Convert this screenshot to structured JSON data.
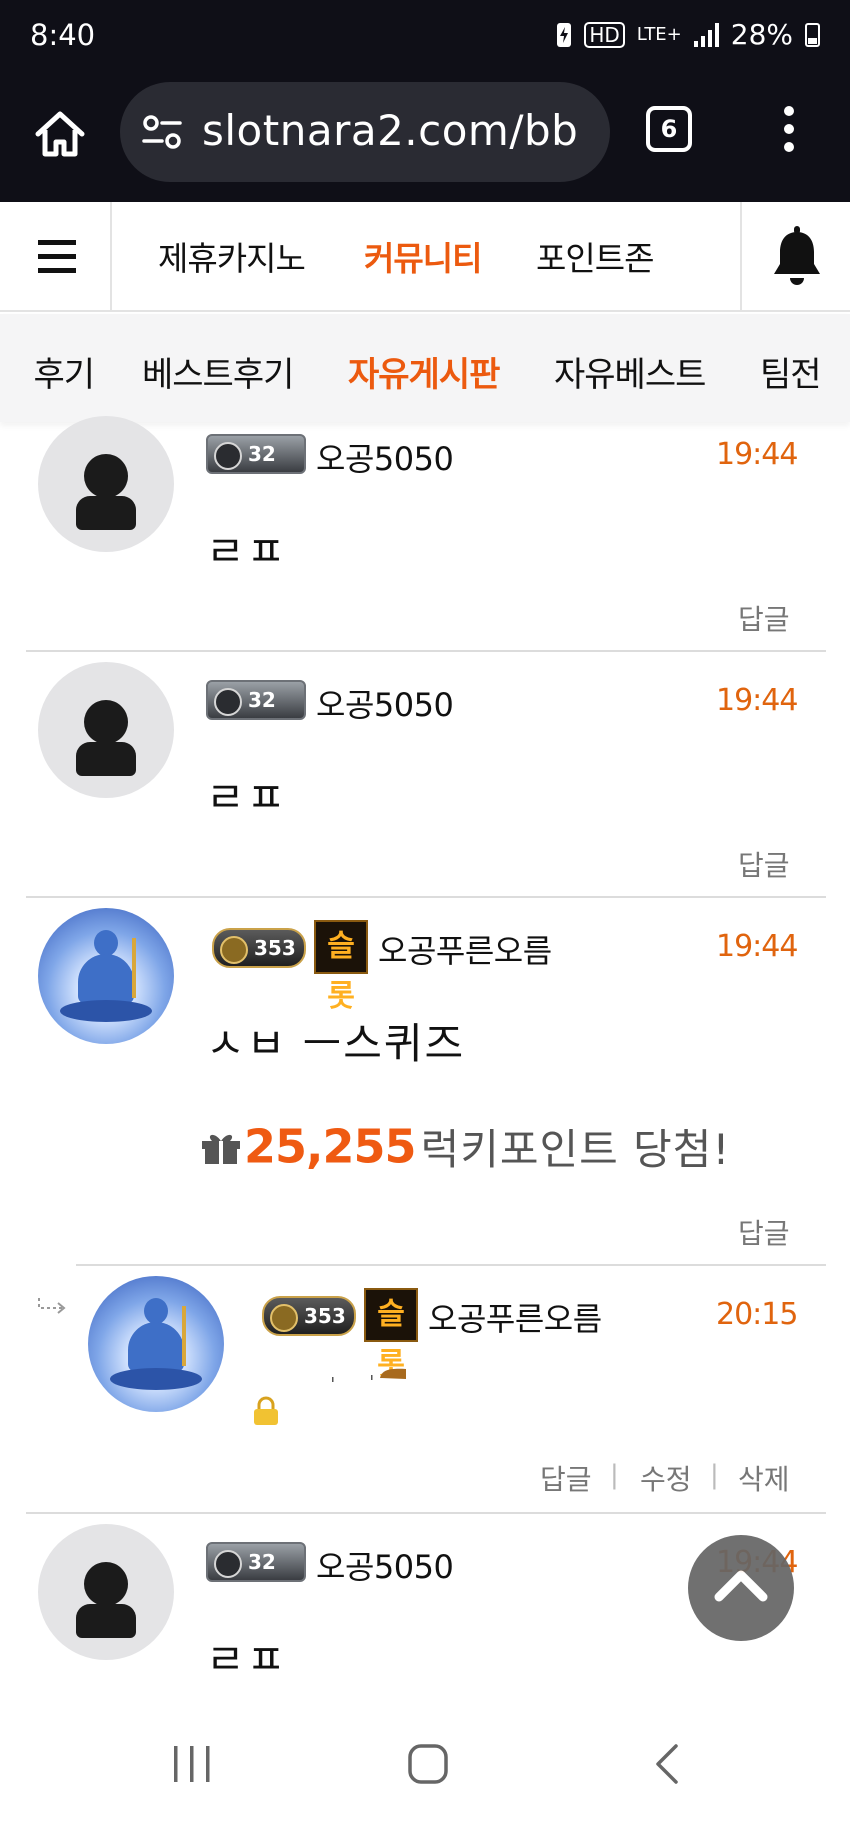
{
  "status_bar": {
    "time": "8:40",
    "hd_label": "HD",
    "network": "LTE+",
    "battery": "28%"
  },
  "browser": {
    "url": "slotnara2.com/bb",
    "tab_count": "6"
  },
  "site_nav": {
    "items": [
      {
        "label": "제휴카지노",
        "active": false
      },
      {
        "label": "커뮤니티",
        "active": true
      },
      {
        "label": "포인트존",
        "active": false
      }
    ]
  },
  "sub_nav": {
    "items": [
      {
        "label": "후기",
        "active": false
      },
      {
        "label": "베스트후기",
        "active": false
      },
      {
        "label": "자유게시판",
        "active": true
      },
      {
        "label": "자유베스트",
        "active": false
      },
      {
        "label": "팀전",
        "active": false
      }
    ]
  },
  "comments": [
    {
      "level_badge": "32",
      "nickname": "오공5050",
      "time": "19:44",
      "text": "ㄹㅍ",
      "reply_label": "답글"
    },
    {
      "level_badge": "32",
      "nickname": "오공5050",
      "time": "19:44",
      "text": "ㄹㅍ",
      "reply_label": "답글"
    },
    {
      "level_badge": "353",
      "slot_badge": "슬롯",
      "nickname": "오공푸른오름",
      "time": "19:44",
      "text": "ㅅㅂ ㅡ스퀴즈",
      "lucky_points": "25,255",
      "lucky_text": "럭키포인트 당첨!",
      "reply_label": "답글"
    },
    {
      "level_badge": "353",
      "slot_badge": "슬롯",
      "nickname": "오공푸른오름",
      "time": "20:15",
      "reply_label": "답글",
      "edit_label": "수정",
      "delete_label": "삭제",
      "secret": true
    },
    {
      "level_badge": "32",
      "nickname": "오공5050",
      "time": "19:44",
      "text": "ㄹㅍ"
    }
  ],
  "icons": [
    "home-icon",
    "tune-icon",
    "more-vert-icon",
    "menu-icon",
    "bell-icon",
    "user-icon",
    "gift-icon",
    "lock-icon",
    "reply-arrow-icon",
    "chevron-up-icon",
    "recent-apps-icon",
    "home-circle-icon",
    "back-icon"
  ],
  "colors": {
    "accent": "#ec5a0f",
    "time": "#e0640e",
    "lucky": "#ef5a12"
  }
}
